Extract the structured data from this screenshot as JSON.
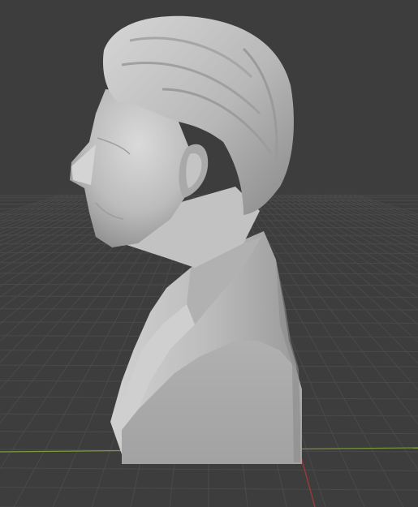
{
  "viewport": {
    "background_color": "#3d3d3d",
    "grid_line_color": "#4a4a4a",
    "x_axis_color": "#7e9a3c",
    "y_axis_color": "#9a3a3a"
  },
  "object": {
    "name": "bust",
    "material_color": "#b6b6b6",
    "shadow_color": "#8e8e8e",
    "base_color": "#a8a8a8"
  }
}
